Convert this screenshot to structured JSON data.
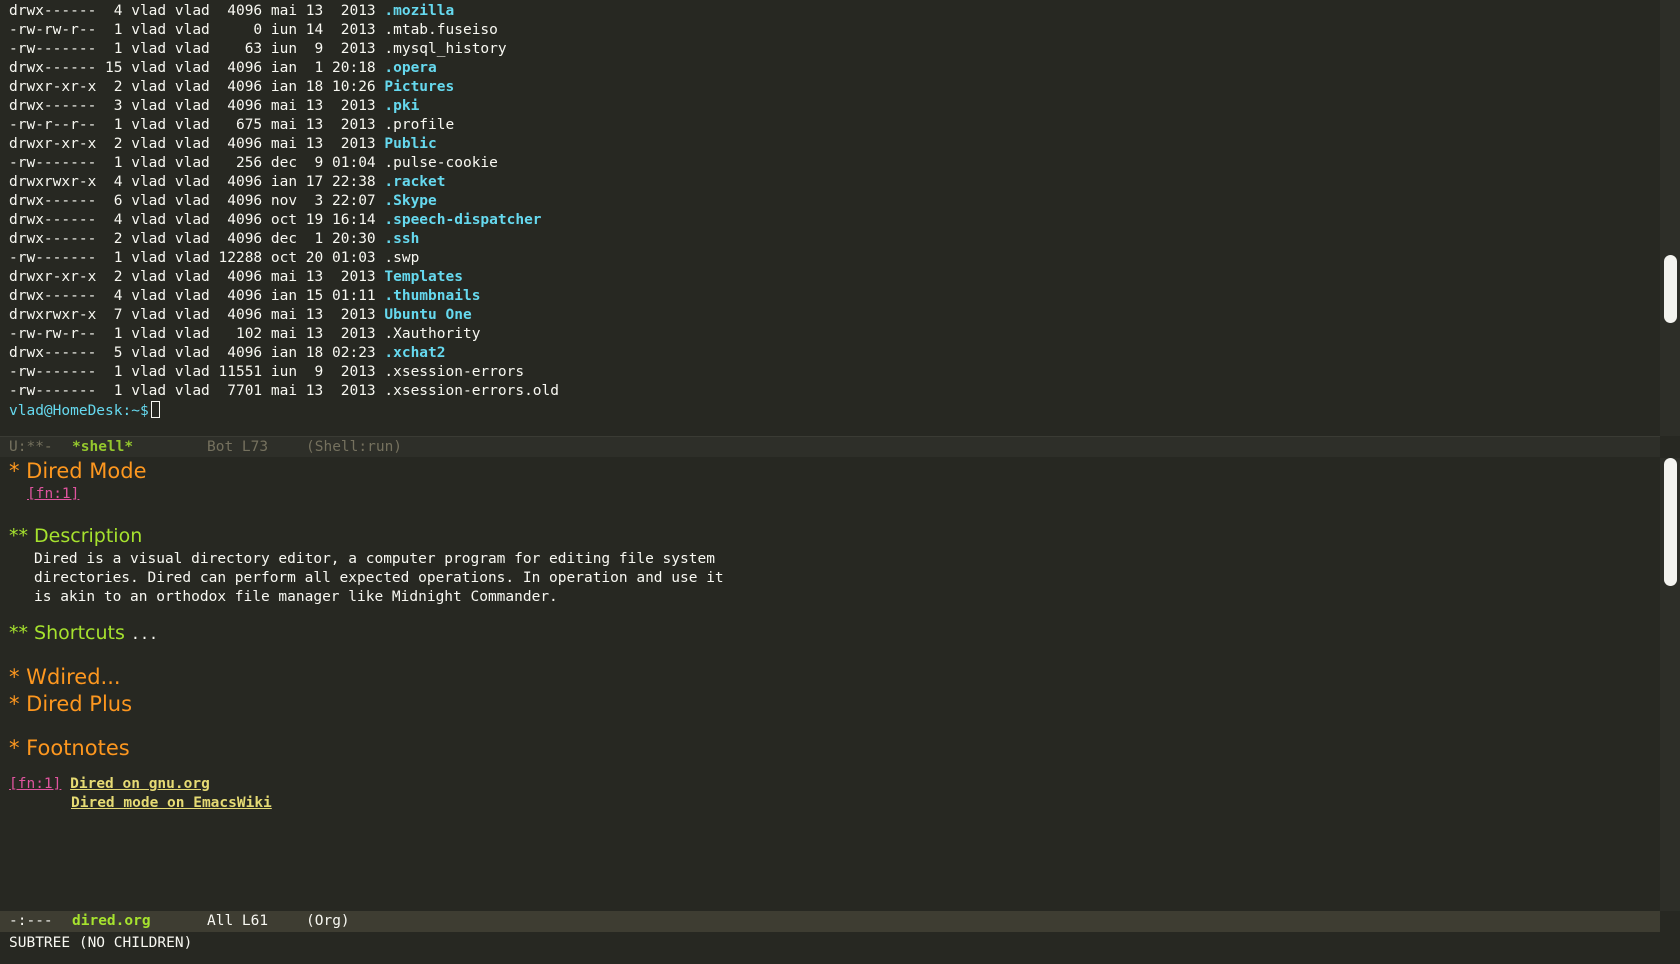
{
  "shell": {
    "listing": [
      {
        "perms": "drwx------",
        "links": "4",
        "user": "vlad",
        "group": "vlad",
        "size": "4096",
        "month": "mai",
        "day": "13",
        "time": "2013",
        "name": ".mozilla",
        "dir": true
      },
      {
        "perms": "-rw-rw-r--",
        "links": "1",
        "user": "vlad",
        "group": "vlad",
        "size": "0",
        "month": "iun",
        "day": "14",
        "time": "2013",
        "name": ".mtab.fuseiso",
        "dir": false
      },
      {
        "perms": "-rw-------",
        "links": "1",
        "user": "vlad",
        "group": "vlad",
        "size": "63",
        "month": "iun",
        "day": "9",
        "time": "2013",
        "name": ".mysql_history",
        "dir": false
      },
      {
        "perms": "drwx------",
        "links": "15",
        "user": "vlad",
        "group": "vlad",
        "size": "4096",
        "month": "ian",
        "day": "1",
        "time": "20:18",
        "name": ".opera",
        "dir": true
      },
      {
        "perms": "drwxr-xr-x",
        "links": "2",
        "user": "vlad",
        "group": "vlad",
        "size": "4096",
        "month": "ian",
        "day": "18",
        "time": "10:26",
        "name": "Pictures",
        "dir": true
      },
      {
        "perms": "drwx------",
        "links": "3",
        "user": "vlad",
        "group": "vlad",
        "size": "4096",
        "month": "mai",
        "day": "13",
        "time": "2013",
        "name": ".pki",
        "dir": true
      },
      {
        "perms": "-rw-r--r--",
        "links": "1",
        "user": "vlad",
        "group": "vlad",
        "size": "675",
        "month": "mai",
        "day": "13",
        "time": "2013",
        "name": ".profile",
        "dir": false
      },
      {
        "perms": "drwxr-xr-x",
        "links": "2",
        "user": "vlad",
        "group": "vlad",
        "size": "4096",
        "month": "mai",
        "day": "13",
        "time": "2013",
        "name": "Public",
        "dir": true
      },
      {
        "perms": "-rw-------",
        "links": "1",
        "user": "vlad",
        "group": "vlad",
        "size": "256",
        "month": "dec",
        "day": "9",
        "time": "01:04",
        "name": ".pulse-cookie",
        "dir": false
      },
      {
        "perms": "drwxrwxr-x",
        "links": "4",
        "user": "vlad",
        "group": "vlad",
        "size": "4096",
        "month": "ian",
        "day": "17",
        "time": "22:38",
        "name": ".racket",
        "dir": true
      },
      {
        "perms": "drwx------",
        "links": "6",
        "user": "vlad",
        "group": "vlad",
        "size": "4096",
        "month": "nov",
        "day": "3",
        "time": "22:07",
        "name": ".Skype",
        "dir": true
      },
      {
        "perms": "drwx------",
        "links": "4",
        "user": "vlad",
        "group": "vlad",
        "size": "4096",
        "month": "oct",
        "day": "19",
        "time": "16:14",
        "name": ".speech-dispatcher",
        "dir": true
      },
      {
        "perms": "drwx------",
        "links": "2",
        "user": "vlad",
        "group": "vlad",
        "size": "4096",
        "month": "dec",
        "day": "1",
        "time": "20:30",
        "name": ".ssh",
        "dir": true
      },
      {
        "perms": "-rw-------",
        "links": "1",
        "user": "vlad",
        "group": "vlad",
        "size": "12288",
        "month": "oct",
        "day": "20",
        "time": "01:03",
        "name": ".swp",
        "dir": false
      },
      {
        "perms": "drwxr-xr-x",
        "links": "2",
        "user": "vlad",
        "group": "vlad",
        "size": "4096",
        "month": "mai",
        "day": "13",
        "time": "2013",
        "name": "Templates",
        "dir": true
      },
      {
        "perms": "drwx------",
        "links": "4",
        "user": "vlad",
        "group": "vlad",
        "size": "4096",
        "month": "ian",
        "day": "15",
        "time": "01:11",
        "name": ".thumbnails",
        "dir": true
      },
      {
        "perms": "drwxrwxr-x",
        "links": "7",
        "user": "vlad",
        "group": "vlad",
        "size": "4096",
        "month": "mai",
        "day": "13",
        "time": "2013",
        "name": "Ubuntu One",
        "dir": true
      },
      {
        "perms": "-rw-rw-r--",
        "links": "1",
        "user": "vlad",
        "group": "vlad",
        "size": "102",
        "month": "mai",
        "day": "13",
        "time": "2013",
        "name": ".Xauthority",
        "dir": false
      },
      {
        "perms": "drwx------",
        "links": "5",
        "user": "vlad",
        "group": "vlad",
        "size": "4096",
        "month": "ian",
        "day": "18",
        "time": "02:23",
        "name": ".xchat2",
        "dir": true
      },
      {
        "perms": "-rw-------",
        "links": "1",
        "user": "vlad",
        "group": "vlad",
        "size": "11551",
        "month": "iun",
        "day": "9",
        "time": "2013",
        "name": ".xsession-errors",
        "dir": false
      },
      {
        "perms": "-rw-------",
        "links": "1",
        "user": "vlad",
        "group": "vlad",
        "size": "7701",
        "month": "mai",
        "day": "13",
        "time": "2013",
        "name": ".xsession-errors.old",
        "dir": false
      }
    ],
    "prompt": "vlad@HomeDesk:~$"
  },
  "modeline_shell": {
    "status": "U:**-",
    "buffer": "*shell*",
    "position": "Bot L73",
    "mode": "(Shell:run)"
  },
  "org": {
    "h_dired_mode": "* Dired Mode",
    "fnref_top": "[fn:1]",
    "h_description": "** Description",
    "description_lines": [
      "Dired is a visual directory editor, a computer program for editing file system",
      "directories. Dired can perform all expected operations. In operation and use it",
      "is akin to an orthodox file manager like Midnight Commander."
    ],
    "h_shortcuts": "** Shortcuts",
    "shortcuts_ellipsis": "...",
    "h_wdired": "* Wdired...",
    "h_dired_plus": "* Dired Plus",
    "h_footnotes": "* Footnotes",
    "fn_label": "[fn:1]",
    "link_gnu": "Dired on gnu.org",
    "link_wiki": "Dired mode on EmacsWiki"
  },
  "modeline_org": {
    "status": "-:---",
    "buffer": "dired.org",
    "position": "All L61",
    "mode": "(Org)"
  },
  "echo_area": "SUBTREE (NO CHILDREN)",
  "colors": {
    "background": "#272822",
    "directory": "#66d9ef",
    "heading1": "#fd971f",
    "heading2": "#a6e22e",
    "link": "#e6db74",
    "footnote": "#e0549f"
  }
}
